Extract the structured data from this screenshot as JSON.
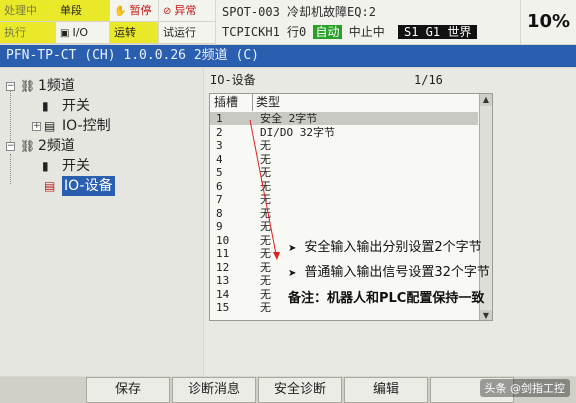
{
  "status": {
    "busy": "处理中",
    "step": "单段",
    "hold": "暂停",
    "fault": "异常",
    "run": "执行",
    "io": "I/O",
    "prod": "运转",
    "tcyc": "试运行"
  },
  "header": {
    "program": "SPOT-003",
    "message": "冷却机故障EQ:2",
    "line": "TCPICKH1 行0",
    "mode": "自动",
    "state": "中止中",
    "frame": "S1 G1 世界",
    "override": "10%"
  },
  "title": "PFN-TP-CT (CH) 1.0.0.26 2频道 (C)",
  "tree": {
    "items": [
      {
        "label": "1频道",
        "icon": "network-icon"
      },
      {
        "label": "开关",
        "icon": "switch-icon"
      },
      {
        "label": "IO-控制",
        "icon": "io-module-icon"
      },
      {
        "label": "2频道",
        "icon": "network-icon"
      },
      {
        "label": "开关",
        "icon": "switch-icon"
      },
      {
        "label": "IO-设备",
        "icon": "io-module-icon"
      }
    ]
  },
  "content": {
    "heading": "IO-设备",
    "page": "1/16",
    "columns": [
      "插槽",
      "类型"
    ],
    "rows": [
      {
        "slot": "1",
        "type": "安全 2字节"
      },
      {
        "slot": "2",
        "type": "DI/DO 32字节"
      },
      {
        "slot": "3",
        "type": "无"
      },
      {
        "slot": "4",
        "type": "无"
      },
      {
        "slot": "5",
        "type": "无"
      },
      {
        "slot": "6",
        "type": "无"
      },
      {
        "slot": "7",
        "type": "无"
      },
      {
        "slot": "8",
        "type": "无"
      },
      {
        "slot": "9",
        "type": "无"
      },
      {
        "slot": "10",
        "type": "无"
      },
      {
        "slot": "11",
        "type": "无"
      },
      {
        "slot": "12",
        "type": "无"
      },
      {
        "slot": "13",
        "type": "无"
      },
      {
        "slot": "14",
        "type": "无"
      },
      {
        "slot": "15",
        "type": "无"
      }
    ]
  },
  "notes": {
    "note1": "安全输入输出分别设置2个字节",
    "note2": "普通输入输出信号设置32个字节",
    "remark": "备注：机器人和PLC配置保持一致",
    "arrow_color": "#e02020"
  },
  "softkeys": [
    "保存",
    "诊断消息",
    "安全诊断",
    "编辑",
    ""
  ],
  "watermark": "头条 @剑指工控"
}
